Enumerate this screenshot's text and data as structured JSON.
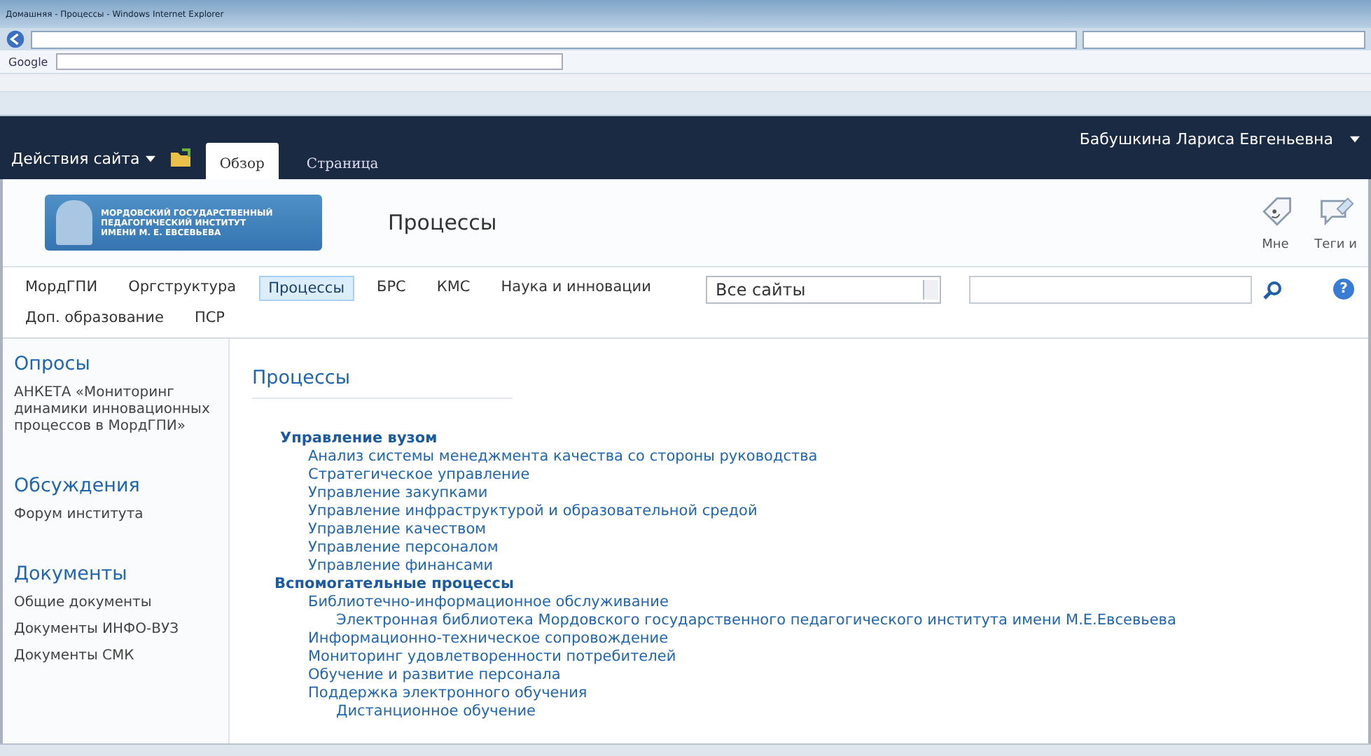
{
  "browser": {
    "title": "Домашняя - Процессы - Windows Internet Explorer",
    "google_label": "Google"
  },
  "ribbon": {
    "site_actions": "Действия сайта",
    "tabs": [
      {
        "label": "Обзор",
        "selected": true
      },
      {
        "label": "Страница",
        "selected": false
      }
    ],
    "user": "Бабушкина Лариса Евгеньевна"
  },
  "header": {
    "logo_lines": [
      "МОРДОВСКИЙ ГОСУДАРСТВЕННЫЙ",
      "ПЕДАГОГИЧЕСКИЙ ИНСТИТУТ",
      "ИМЕНИ М. Е. ЕВСЕВЬЕВА"
    ],
    "title": "Процессы",
    "actions": [
      {
        "kind": "like",
        "label": "Мне"
      },
      {
        "kind": "tags",
        "label": "Теги и"
      }
    ]
  },
  "nav": {
    "items": [
      {
        "label": "МордГПИ",
        "selected": false
      },
      {
        "label": "Оргструктура",
        "selected": false
      },
      {
        "label": "Процессы",
        "selected": true
      },
      {
        "label": "БРС",
        "selected": false
      },
      {
        "label": "КМС",
        "selected": false
      },
      {
        "label": "Наука и инновации",
        "selected": false
      },
      {
        "label": "Доп. образование",
        "selected": false
      },
      {
        "label": "ПСР",
        "selected": false
      }
    ],
    "scope": "Все сайты",
    "help": "?"
  },
  "sidebar": [
    {
      "heading": "Опросы",
      "items": [
        "АНКЕТА «Мониторинг динамики инновационных процессов в МордГПИ»"
      ]
    },
    {
      "heading": "Обсуждения",
      "items": [
        "Форум института"
      ]
    },
    {
      "heading": "Документы",
      "items": [
        "Общие документы",
        "Документы ИНФО-ВУЗ",
        "Документы СМК"
      ]
    }
  ],
  "content": {
    "title": "Процессы",
    "tree": [
      {
        "label": "Управление вузом",
        "children": [
          {
            "label": "Анализ системы менеджмента качества со стороны руководства"
          },
          {
            "label": "Стратегическое управление"
          },
          {
            "label": "Управление закупками"
          },
          {
            "label": "Управление инфраструктурой и образовательной средой"
          },
          {
            "label": "Управление качеством"
          },
          {
            "label": "Управление персоналом"
          },
          {
            "label": "Управление финансами"
          }
        ]
      },
      {
        "label": "Вспомогательные процессы",
        "children": [
          {
            "label": "Библиотечно-информационное обслуживание",
            "children": [
              {
                "label": "Электронная библиотека Мордовского государственного педагогического института имени М.Е.Евсевьева"
              }
            ]
          },
          {
            "label": "Информационно-техническое сопровождение"
          },
          {
            "label": "Мониторинг удовлетворенности потребителей"
          },
          {
            "label": "Обучение и развитие персонала"
          },
          {
            "label": "Поддержка электронного обучения",
            "children": [
              {
                "label": "Дистанционное обучение"
              }
            ]
          }
        ]
      }
    ]
  }
}
